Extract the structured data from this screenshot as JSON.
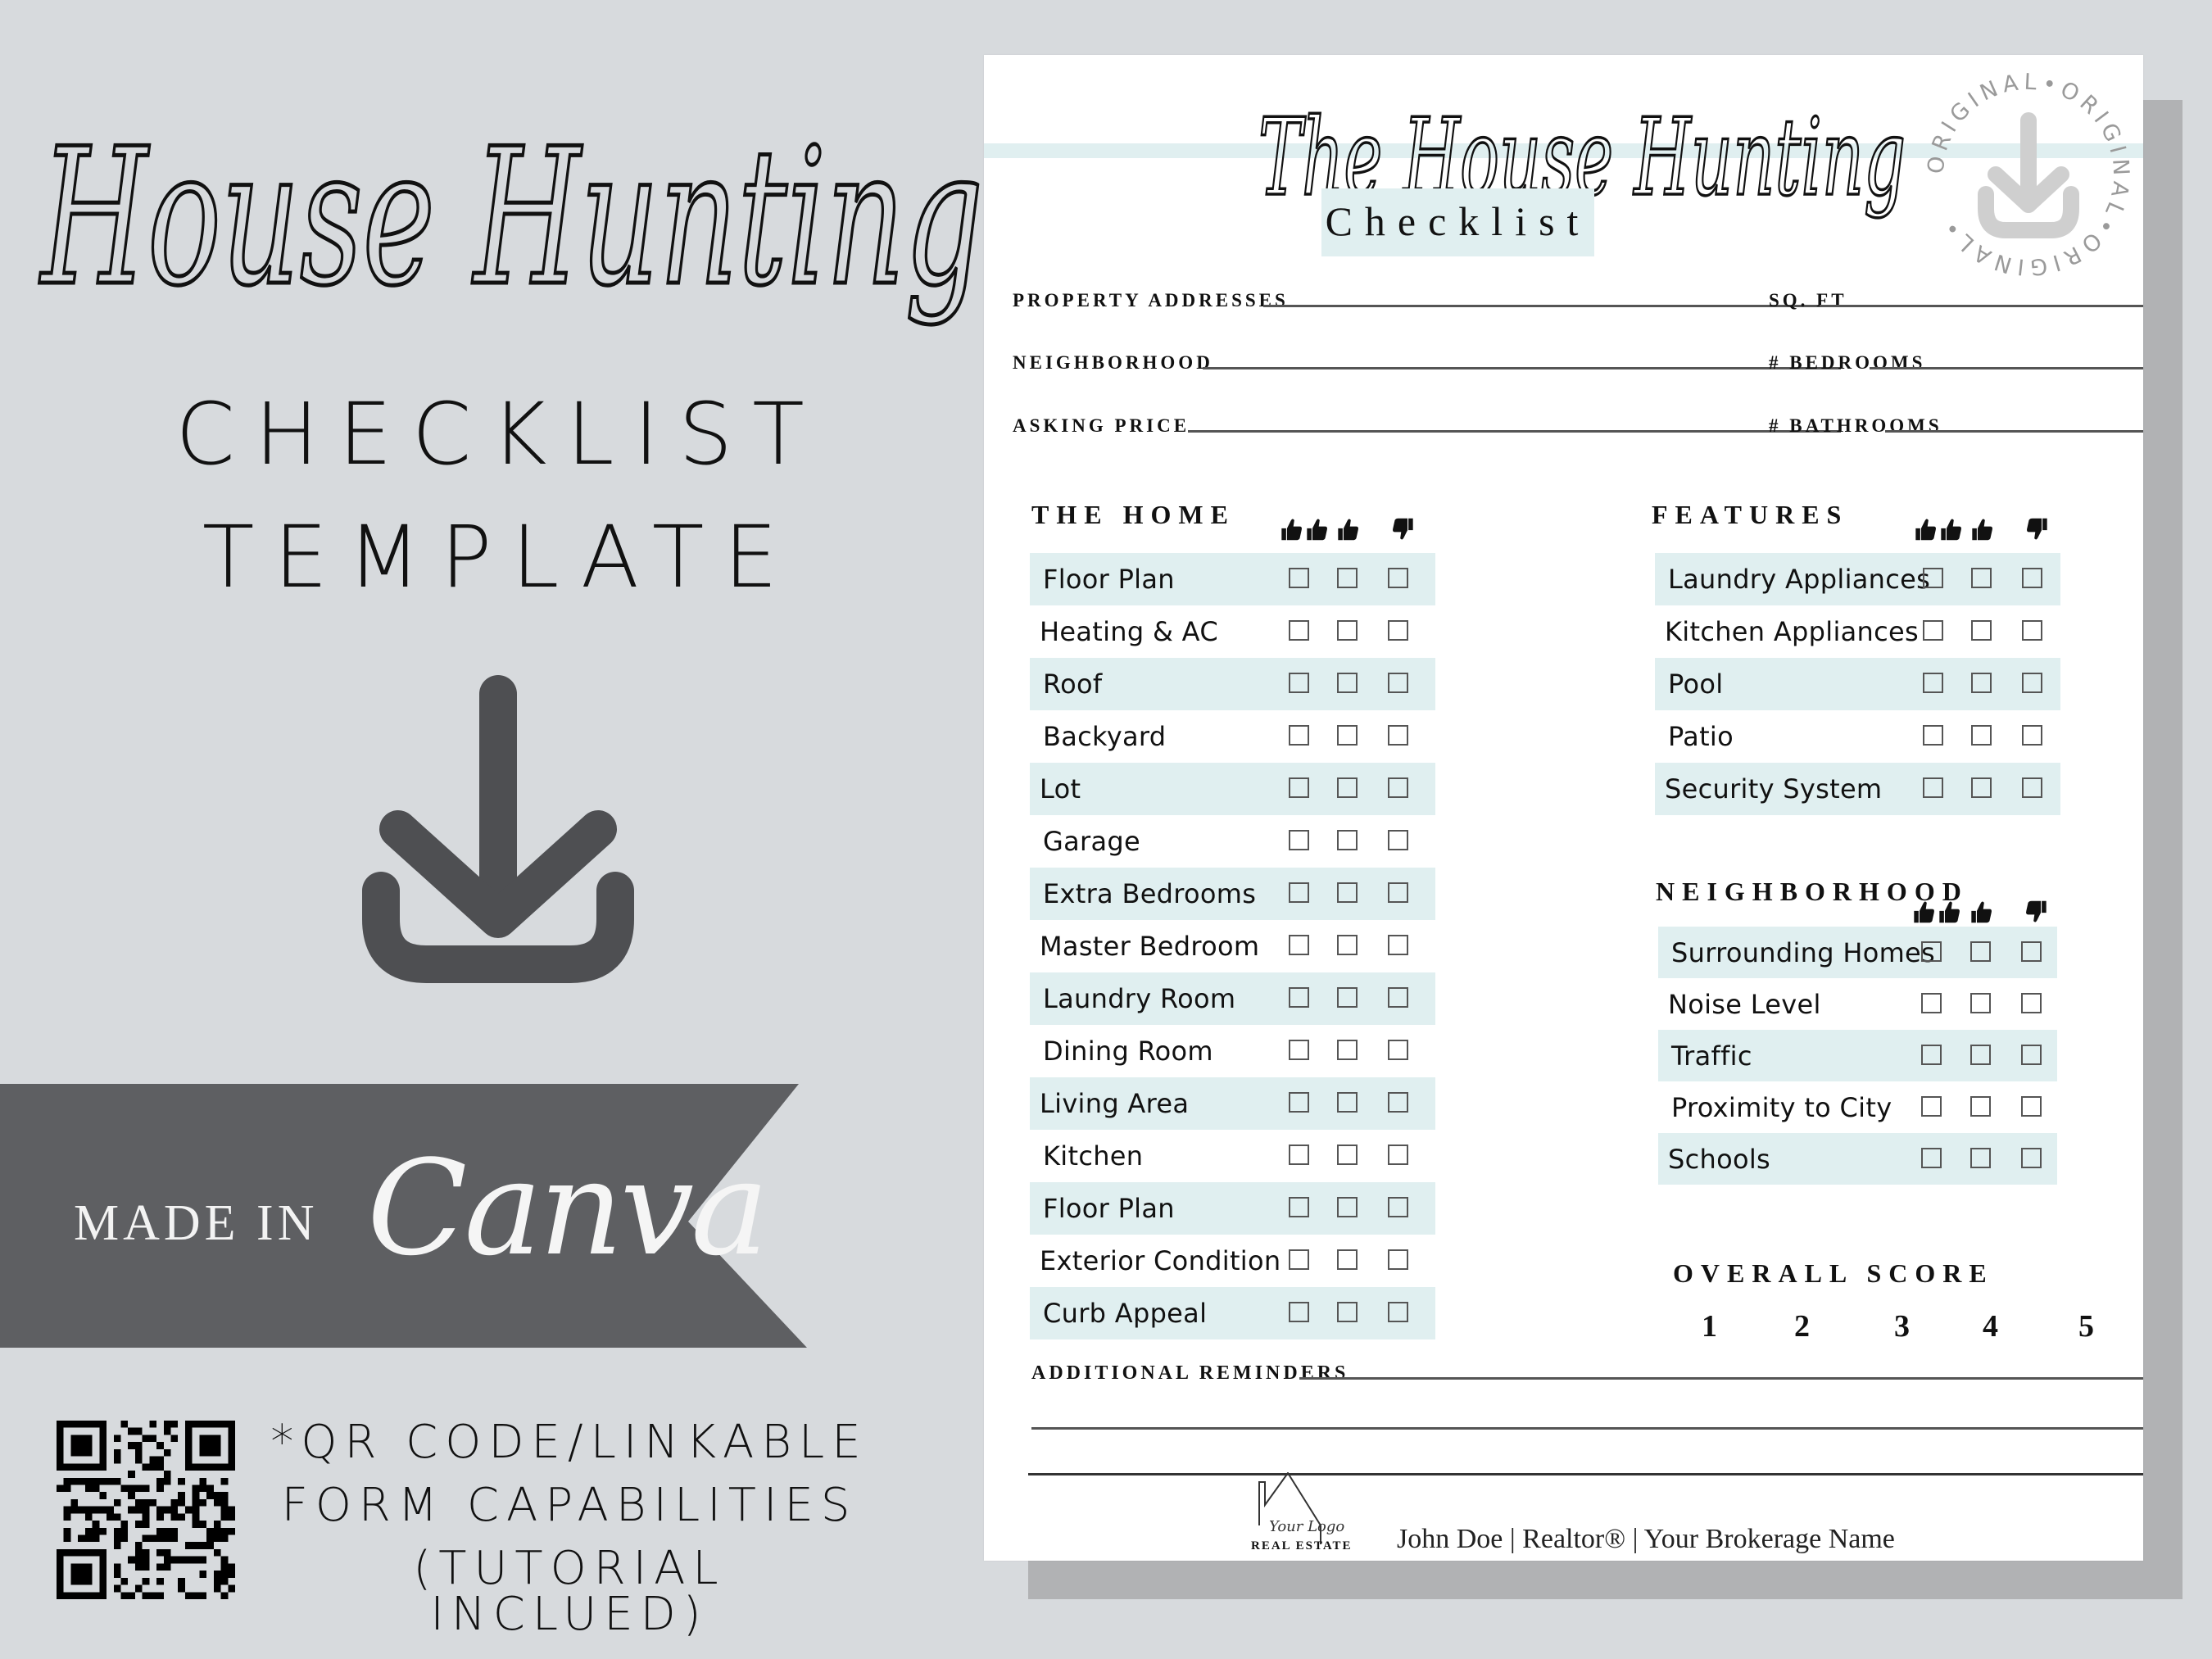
{
  "promo": {
    "script_title": "House Hunting",
    "line1": "CHECKLIST",
    "line2": "TEMPLATE",
    "download_icon": "download-icon",
    "ribbon": {
      "made_in": "MADE IN",
      "brand": "Canva"
    },
    "qr_icon": "qr-code-icon",
    "qr_text": [
      "*QR CODE/LINKABLE",
      "FORM CAPABILITIES",
      "(TUTORIAL INCLUED)"
    ]
  },
  "colors": {
    "background": "#d7dadd",
    "ribbon": "#5e5f62",
    "icon": "#4e4f52",
    "accent_band": "#e0eff0",
    "shadow": "#b1b2b4"
  },
  "document": {
    "title_script": "The House Hunting",
    "title_box": "Checklist",
    "stamp": {
      "ring_text": "ORIGINAL•ORIGINAL•ORIGINAL•",
      "icon": "download-icon"
    },
    "fields_left": [
      "PROPERTY ADDRESSES",
      "NEIGHBORHOOD",
      "ASKING PRICE"
    ],
    "fields_right": [
      "SQ. FT",
      "# BEDROOMS",
      "# BATHROOMS"
    ],
    "rating_icons": [
      "double-thumbs-up-icon",
      "thumbs-up-icon",
      "thumbs-down-icon"
    ],
    "home": {
      "title": "THE HOME",
      "items": [
        "Floor Plan",
        "Heating & AC",
        "Roof",
        "Backyard",
        "Lot",
        "Garage",
        "Extra Bedrooms",
        "Master Bedroom",
        "Laundry Room",
        "Dining Room",
        "Living Area",
        "Kitchen",
        "Floor Plan",
        "Exterior Condition",
        "Curb Appeal"
      ]
    },
    "features": {
      "title": "FEATURES",
      "items": [
        "Laundry Appliances",
        "Kitchen Appliances",
        "Pool",
        "Patio",
        "Security System"
      ]
    },
    "neighborhood": {
      "title": "NEIGHBORHOOD",
      "items": [
        "Surrounding Homes",
        "Noise Level",
        "Traffic",
        "Proximity to City",
        "Schools"
      ]
    },
    "overall_score": {
      "title": "OVERALL SCORE",
      "values": [
        "1",
        "2",
        "3",
        "4",
        "5"
      ]
    },
    "additional_reminders": "ADDITIONAL REMINDERS",
    "footer": {
      "logo_script": "Your Logo",
      "logo_label": "REAL ESTATE",
      "agent_line": "John Doe | Realtor® | Your Brokerage Name"
    }
  }
}
